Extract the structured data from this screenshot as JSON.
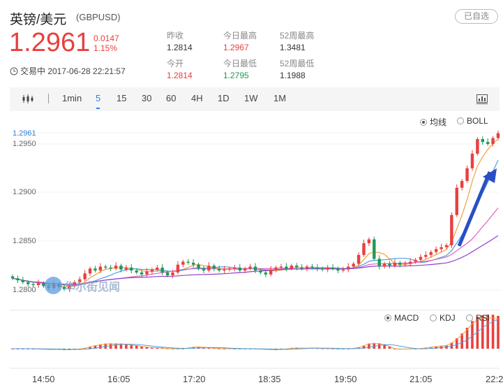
{
  "header": {
    "name": "英镑/美元",
    "code": "(GBPUSD)",
    "favorite_label": "已自选"
  },
  "quote": {
    "price": "1.2961",
    "change": "0.0147",
    "change_pct": "1.15%"
  },
  "stats": {
    "prev_close_label": "昨收",
    "prev_close": "1.2814",
    "open_label": "今开",
    "open": "1.2814",
    "high_label": "今日最高",
    "high": "1.2967",
    "low_label": "今日最低",
    "low": "1.2795",
    "high52_label": "52周最高",
    "high52": "1.3481",
    "low52_label": "52周最低",
    "low52": "1.1988"
  },
  "status": {
    "text": "交易中 2017-06-28 22:21:57"
  },
  "toolbar": {
    "tabs": [
      "1min",
      "5",
      "15",
      "30",
      "60",
      "4H",
      "1D",
      "1W",
      "1M"
    ],
    "active_tab": "5"
  },
  "overlay_options": {
    "ma": "均线",
    "boll": "BOLL",
    "selected": "均线"
  },
  "indicator_options": {
    "macd": "MACD",
    "kdj": "KDJ",
    "rsi": "RSI",
    "selected": "MACD"
  },
  "price_axis": {
    "current": "1.2961",
    "ticks": [
      "1.2950",
      "1.2900",
      "1.2850",
      "1.2800"
    ]
  },
  "time_axis": [
    "14:50",
    "16:05",
    "17:20",
    "18:35",
    "19:50",
    "21:05",
    "22:2"
  ],
  "watermark": "华尔街见闻",
  "colors": {
    "up": "#e8403f",
    "down": "#1a9b55",
    "accent": "#2f7fd8"
  },
  "chart_data": {
    "type": "candlestick",
    "interval": "5",
    "ylim": [
      1.279,
      1.297
    ],
    "candles_close": [
      1.2812,
      1.281,
      1.2808,
      1.2806,
      1.2805,
      1.2807,
      1.2804,
      1.2802,
      1.2806,
      1.2803,
      1.2801,
      1.2804,
      1.2808,
      1.2811,
      1.2817,
      1.2822,
      1.282,
      1.2824,
      1.2823,
      1.2822,
      1.2825,
      1.2821,
      1.2823,
      1.282,
      1.2818,
      1.2816,
      1.2819,
      1.2821,
      1.2823,
      1.2818,
      1.2815,
      1.2818,
      1.2826,
      1.2829,
      1.2828,
      1.2826,
      1.2822,
      1.282,
      1.2825,
      1.2822,
      1.282,
      1.2821,
      1.2822,
      1.2823,
      1.282,
      1.2822,
      1.2824,
      1.282,
      1.2818,
      1.2816,
      1.2821,
      1.2823,
      1.2824,
      1.2822,
      1.2825,
      1.2823,
      1.2822,
      1.2824,
      1.2823,
      1.2822,
      1.2821,
      1.2823,
      1.2822,
      1.282,
      1.2821,
      1.2824,
      1.2827,
      1.2836,
      1.2848,
      1.2852,
      1.2832,
      1.2824,
      1.2827,
      1.2825,
      1.2828,
      1.2826,
      1.2827,
      1.2829,
      1.2831,
      1.2834,
      1.2836,
      1.2839,
      1.2842,
      1.2844,
      1.2846,
      1.2877,
      1.2905,
      1.2912,
      1.2925,
      1.294,
      1.2955,
      1.2952,
      1.295,
      1.2956,
      1.2961
    ]
  }
}
